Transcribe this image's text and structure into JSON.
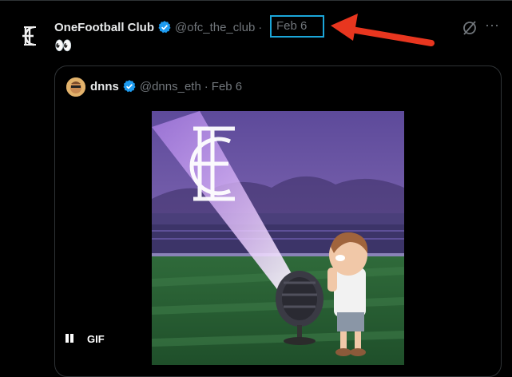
{
  "tweet": {
    "author_name": "OneFootball Club",
    "author_handle": "@ofc_the_club",
    "separator": "·",
    "date": "Feb 6",
    "text": "👀",
    "more_label": "···"
  },
  "quoted_tweet": {
    "author_name": "dnns",
    "author_handle": "@dnns_eth",
    "separator": "·",
    "date": "Feb 6",
    "media_badge": "GIF"
  },
  "colors": {
    "background": "#000000",
    "verified": "#1d9bf0",
    "highlight_box": "#1ba6d9",
    "annotation_arrow": "#e8361f"
  },
  "icons": [
    "ofc-logo-icon",
    "verified-badge-icon",
    "grok-icon",
    "more-icon",
    "pause-icon",
    "annotation-arrow-icon"
  ]
}
